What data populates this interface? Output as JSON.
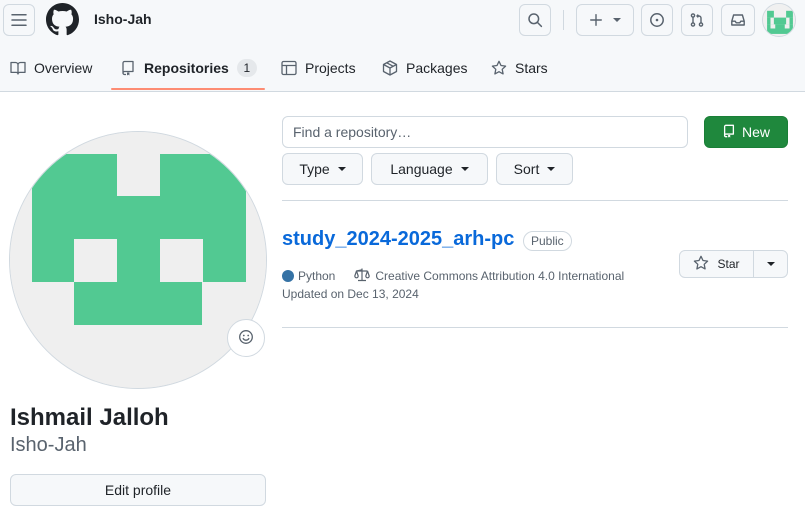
{
  "header": {
    "username": "Isho-Jah",
    "icons": {
      "menu": "hamburger-icon",
      "logo": "github-logo",
      "search": "search-icon",
      "create": "plus-icon",
      "issues": "issue-opened-icon",
      "pulls": "git-pull-request-icon",
      "inbox": "inbox-icon"
    }
  },
  "tabs": [
    {
      "label": "Overview",
      "icon": "book-icon"
    },
    {
      "label": "Repositories",
      "icon": "repo-icon",
      "count": "1",
      "selected": true
    },
    {
      "label": "Projects",
      "icon": "table-icon"
    },
    {
      "label": "Packages",
      "icon": "package-icon"
    },
    {
      "label": "Stars",
      "icon": "star-icon"
    }
  ],
  "profile": {
    "full_name": "Ishmail Jalloh",
    "login": "Isho-Jah",
    "edit_label": "Edit profile"
  },
  "repo_list": {
    "search_placeholder": "Find a repository…",
    "new_label": "New",
    "filters": [
      {
        "label": "Type"
      },
      {
        "label": "Language"
      },
      {
        "label": "Sort"
      }
    ],
    "repos": [
      {
        "name": "study_2024-2025_arh-pc",
        "visibility": "Public",
        "language": "Python",
        "language_color": "#3572a5",
        "license": "Creative Commons Attribution 4.0 International",
        "updated": "Updated on Dec 13, 2024",
        "star_label": "Star"
      }
    ]
  },
  "colors": {
    "accent_blue": "#0969da",
    "primary_green": "#1f883d",
    "identicon_green": "#52c992",
    "tab_underline": "#fd8c73"
  }
}
